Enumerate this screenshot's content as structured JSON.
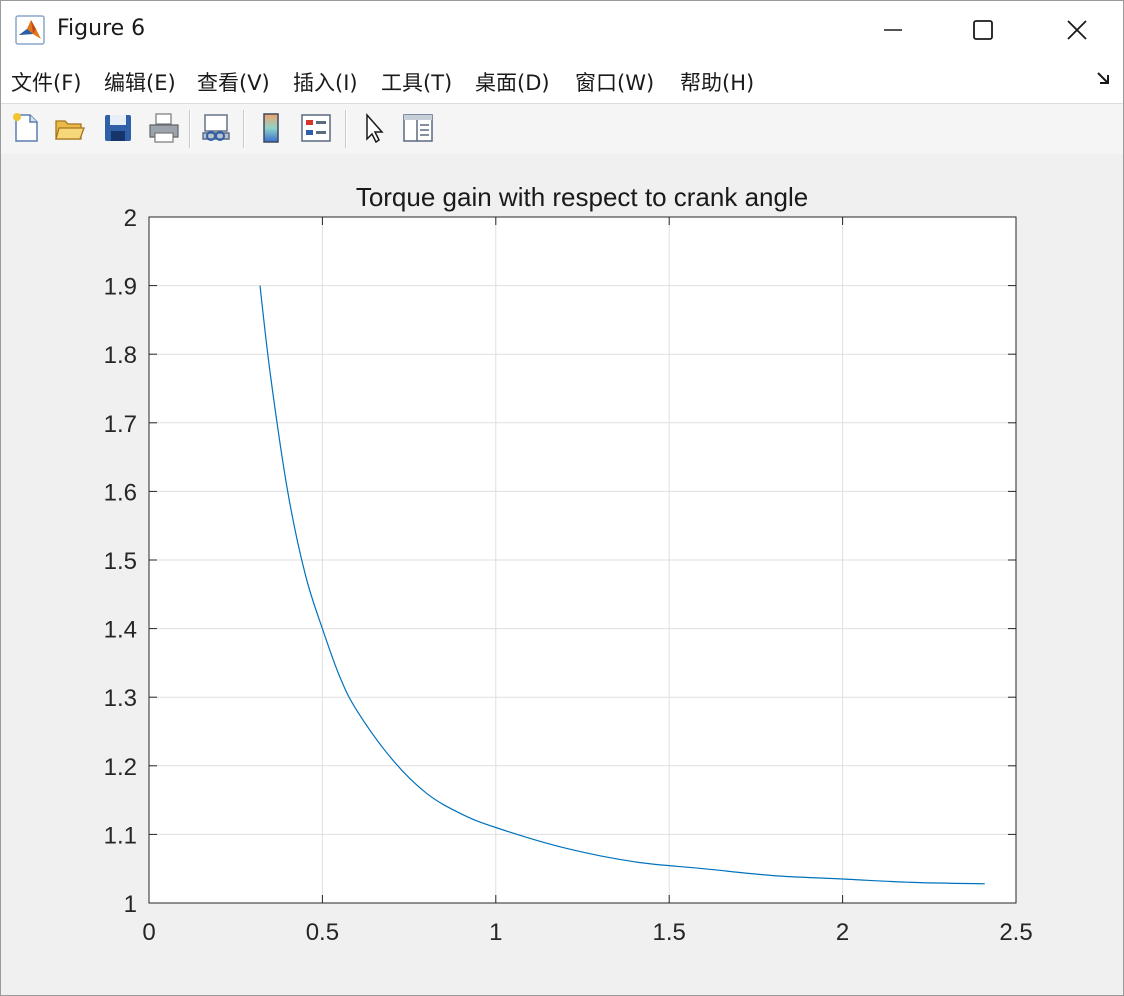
{
  "window": {
    "title": "Figure 6"
  },
  "menu": [
    {
      "label": "文件(F)"
    },
    {
      "label": "编辑(E)"
    },
    {
      "label": "查看(V)"
    },
    {
      "label": "插入(I)"
    },
    {
      "label": "工具(T)"
    },
    {
      "label": "桌面(D)"
    },
    {
      "label": "窗口(W)"
    },
    {
      "label": "帮助(H)"
    }
  ],
  "toolbar": [
    "new-figure-icon",
    "open-file-icon",
    "save-icon",
    "print-icon",
    "link-plot-icon",
    "colorbar-icon",
    "legend-icon",
    "pointer-icon",
    "property-inspector-icon"
  ],
  "colors": {
    "line": "#0072bd",
    "grid": "#dfdfdf",
    "axes": "#262626"
  },
  "chart_data": {
    "type": "line",
    "title": "Torque gain with respect to crank angle",
    "xlabel": "",
    "ylabel": "",
    "xlim": [
      0,
      2.5
    ],
    "ylim": [
      1,
      2
    ],
    "xticks": [
      "0",
      "0.5",
      "1",
      "1.5",
      "2",
      "2.5"
    ],
    "yticks": [
      "1",
      "1.1",
      "1.2",
      "1.3",
      "1.4",
      "1.5",
      "1.6",
      "1.7",
      "1.8",
      "1.9",
      "2"
    ],
    "grid": true,
    "series": [
      {
        "x": [
          0.32,
          0.35,
          0.4,
          0.45,
          0.5,
          0.55,
          0.6,
          0.7,
          0.8,
          0.9,
          1.0,
          1.2,
          1.4,
          1.6,
          1.8,
          2.0,
          2.2,
          2.41
        ],
        "y": [
          1.9,
          1.77,
          1.6,
          1.48,
          1.4,
          1.33,
          1.28,
          1.21,
          1.16,
          1.13,
          1.11,
          1.08,
          1.06,
          1.05,
          1.04,
          1.035,
          1.03,
          1.028
        ]
      }
    ]
  }
}
